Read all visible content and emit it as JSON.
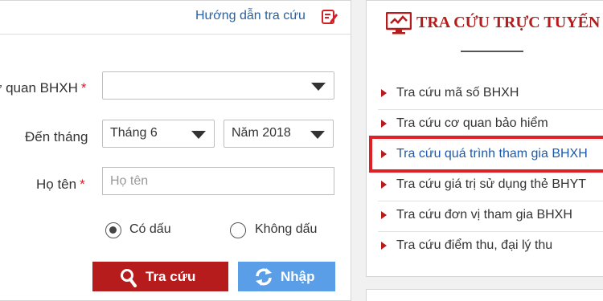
{
  "form": {
    "help_link": "Hướng dẫn tra cứu",
    "agency_label": "ư quan BHXH",
    "required_mark": "*",
    "month_label": "Đến tháng",
    "month_value": "Tháng 6",
    "year_value": "Năm 2018",
    "name_label": "Họ tên",
    "name_placeholder": "Họ tên",
    "radio_accent": "Có dấu",
    "radio_no_accent": "Không dấu",
    "selected_radio": "Có dấu",
    "search_button": "Tra cứu",
    "reset_button": "Nhập"
  },
  "side": {
    "title": "TRA CỨU TRỰC TUYẾN",
    "items": [
      "Tra cứu mã số BHXH",
      "Tra cứu cơ quan bảo hiểm",
      "Tra cứu quá trình tham gia BHXH",
      "Tra cứu giá trị sử dụng thẻ BHYT",
      "Tra cứu đơn vị tham gia BHXH",
      "Tra cứu điểm thu, đại lý thu"
    ],
    "highlighted_item": "Tra cứu quá trình tham gia BHXH"
  },
  "colors": {
    "brand_red": "#b71c1c",
    "link_blue": "#1f5aa8",
    "button_blue": "#5b9ee8",
    "highlight_red": "#e01f26"
  }
}
